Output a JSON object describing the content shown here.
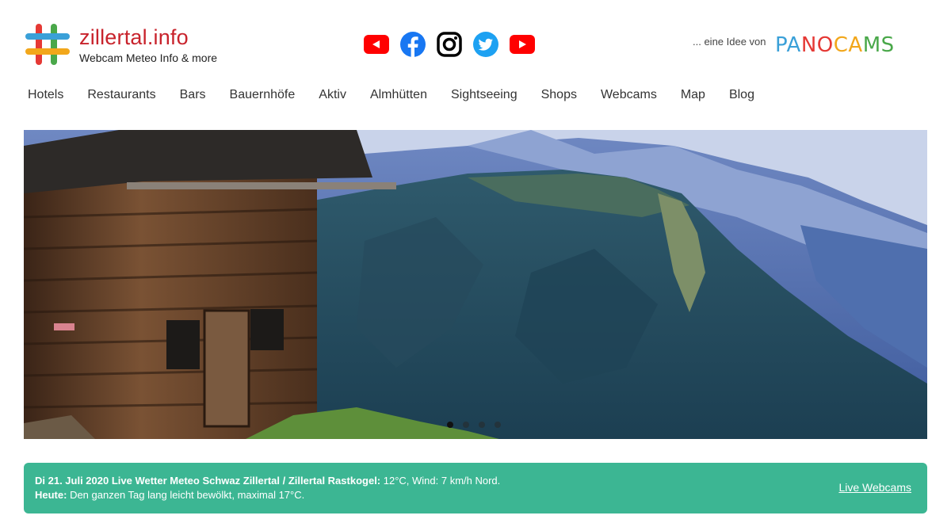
{
  "header": {
    "brand_name": "zillertal.info",
    "brand_tagline": "Webcam Meteo Info & more",
    "idea_text": "... eine Idee von",
    "partner_letters": [
      {
        "ch": "P",
        "color": "#3aa0d8"
      },
      {
        "ch": "A",
        "color": "#3aa0d8"
      },
      {
        "ch": "N",
        "color": "#e53935"
      },
      {
        "ch": "O",
        "color": "#e53935"
      },
      {
        "ch": "C",
        "color": "#f2a71b"
      },
      {
        "ch": "A",
        "color": "#f2a71b"
      },
      {
        "ch": "M",
        "color": "#4aa84a"
      },
      {
        "ch": "S",
        "color": "#4aa84a"
      }
    ],
    "social": [
      "youtube-alt-icon",
      "facebook-icon",
      "instagram-icon",
      "twitter-icon",
      "youtube-icon"
    ]
  },
  "nav": {
    "items": [
      "Hotels",
      "Restaurants",
      "Bars",
      "Bauernhöfe",
      "Aktiv",
      "Almhütten",
      "Sightseeing",
      "Shops",
      "Webcams",
      "Map",
      "Blog"
    ]
  },
  "slider": {
    "slides": 4,
    "active_index": 0
  },
  "weather": {
    "line1_bold": "Di 21. Juli 2020 Live Wetter Meteo Schwaz Zillertal / Zillertal Rastkogel:",
    "line1_text": " 12°C, Wind: 7 km/h Nord.",
    "line2_bold": "Heute:",
    "line2_text": " Den ganzen Tag lang leicht bewölkt, maximal 17°C.",
    "link": "Live Webcams"
  },
  "colors": {
    "brand_red": "#c8232c",
    "weather_green": "#3cb693",
    "facebook_blue": "#1877f2",
    "twitter_blue": "#1da1f2",
    "youtube_red": "#ff0000"
  }
}
